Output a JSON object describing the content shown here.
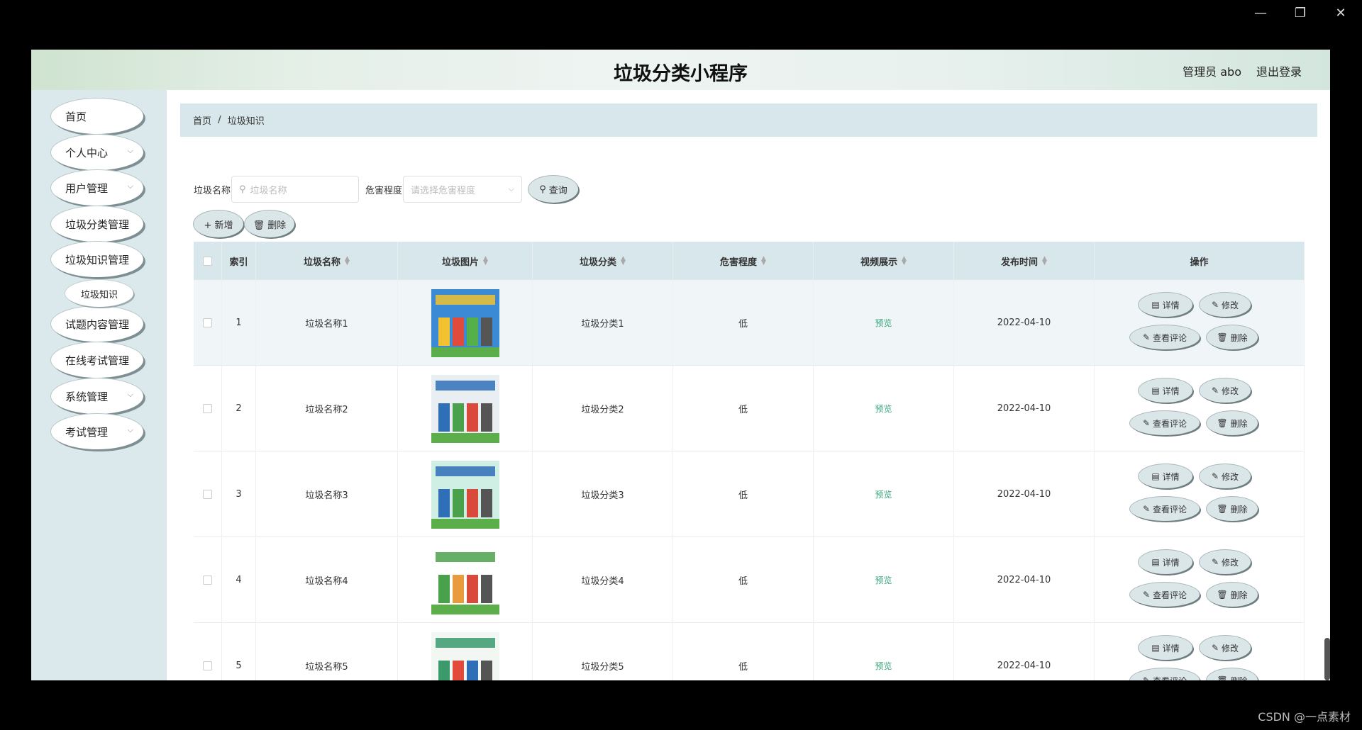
{
  "window": {
    "minimize_glyph": "—",
    "restore_glyph": "❐",
    "close_glyph": "✕"
  },
  "header": {
    "title": "垃圾分类小程序",
    "user": "管理员 abo",
    "logout": "退出登录"
  },
  "sidebar": {
    "items": [
      {
        "label": "首页",
        "has_chevron": false
      },
      {
        "label": "个人中心",
        "has_chevron": true
      },
      {
        "label": "用户管理",
        "has_chevron": true
      },
      {
        "label": "垃圾分类管理",
        "has_chevron": false
      },
      {
        "label": "垃圾知识管理",
        "has_chevron": false
      },
      {
        "label": "试题内容管理",
        "has_chevron": false
      },
      {
        "label": "在线考试管理",
        "has_chevron": false
      },
      {
        "label": "系统管理",
        "has_chevron": true
      },
      {
        "label": "考试管理",
        "has_chevron": true
      }
    ],
    "sub_item": "垃圾知识",
    "chevron": "⌵"
  },
  "breadcrumb": {
    "home": "首页",
    "sep": "/",
    "current": "垃圾知识"
  },
  "search": {
    "name_label": "垃圾名称",
    "name_placeholder": "垃圾名称",
    "level_label": "危害程度",
    "level_placeholder": "请选择危害程度",
    "query_button": "查询",
    "search_glyph": "⚲"
  },
  "toolbar": {
    "add_button": "+ 新增",
    "delete_button": "🗑 删除"
  },
  "table": {
    "columns": [
      "索引",
      "垃圾名称",
      "垃圾图片",
      "垃圾分类",
      "危害程度",
      "视频展示",
      "发布时间",
      "操作"
    ],
    "rows": [
      {
        "index": "1",
        "name": "垃圾名称1",
        "category": "垃圾分类1",
        "level": "低",
        "video": "预览",
        "date": "2022-04-10"
      },
      {
        "index": "2",
        "name": "垃圾名称2",
        "category": "垃圾分类2",
        "level": "低",
        "video": "预览",
        "date": "2022-04-10"
      },
      {
        "index": "3",
        "name": "垃圾名称3",
        "category": "垃圾分类3",
        "level": "低",
        "video": "预览",
        "date": "2022-04-10"
      },
      {
        "index": "4",
        "name": "垃圾名称4",
        "category": "垃圾分类4",
        "level": "低",
        "video": "预览",
        "date": "2022-04-10"
      },
      {
        "index": "5",
        "name": "垃圾名称5",
        "category": "垃圾分类5",
        "level": "低",
        "video": "预览",
        "date": "2022-04-10"
      }
    ],
    "actions": {
      "detail": "详情",
      "edit": "修改",
      "comments": "查看评论",
      "delete": "删除"
    }
  },
  "watermark": "CSDN @一点素材"
}
